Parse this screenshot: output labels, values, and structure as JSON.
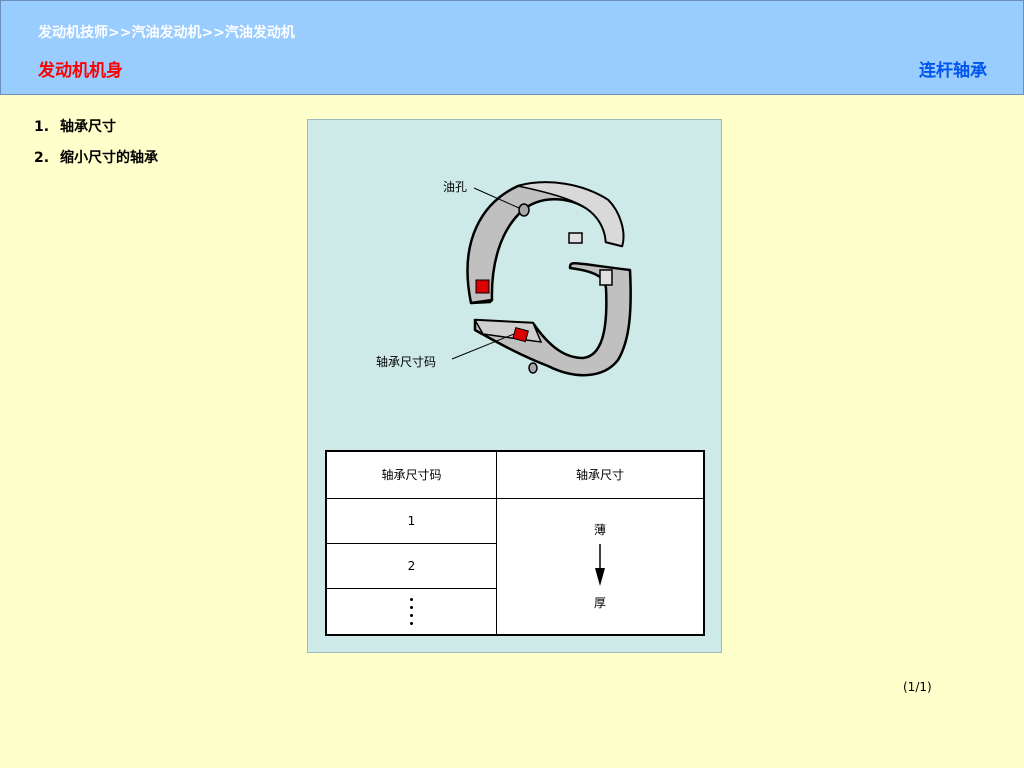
{
  "header": {
    "breadcrumb": "发动机技师>>汽油发动机>>汽油发动机",
    "section_title": "发动机机身",
    "page_heading": "连杆轴承"
  },
  "legend": {
    "items": [
      {
        "num": "1.",
        "label": "轴承尺寸"
      },
      {
        "num": "2.",
        "label": "缩小尺寸的轴承"
      }
    ]
  },
  "figure": {
    "callouts": {
      "oil_hole": "油孔",
      "size_code": "轴承尺寸码"
    },
    "table": {
      "headers": [
        "轴承尺寸码",
        "轴承尺寸"
      ],
      "codes": [
        "1",
        "2"
      ],
      "size_top": "薄",
      "size_bottom": "厚"
    },
    "colors": {
      "bearing_fill": "#c0c0c0",
      "size_mark": "#dd0000",
      "background": "#cdeae8"
    }
  },
  "pager": "(1/1)"
}
